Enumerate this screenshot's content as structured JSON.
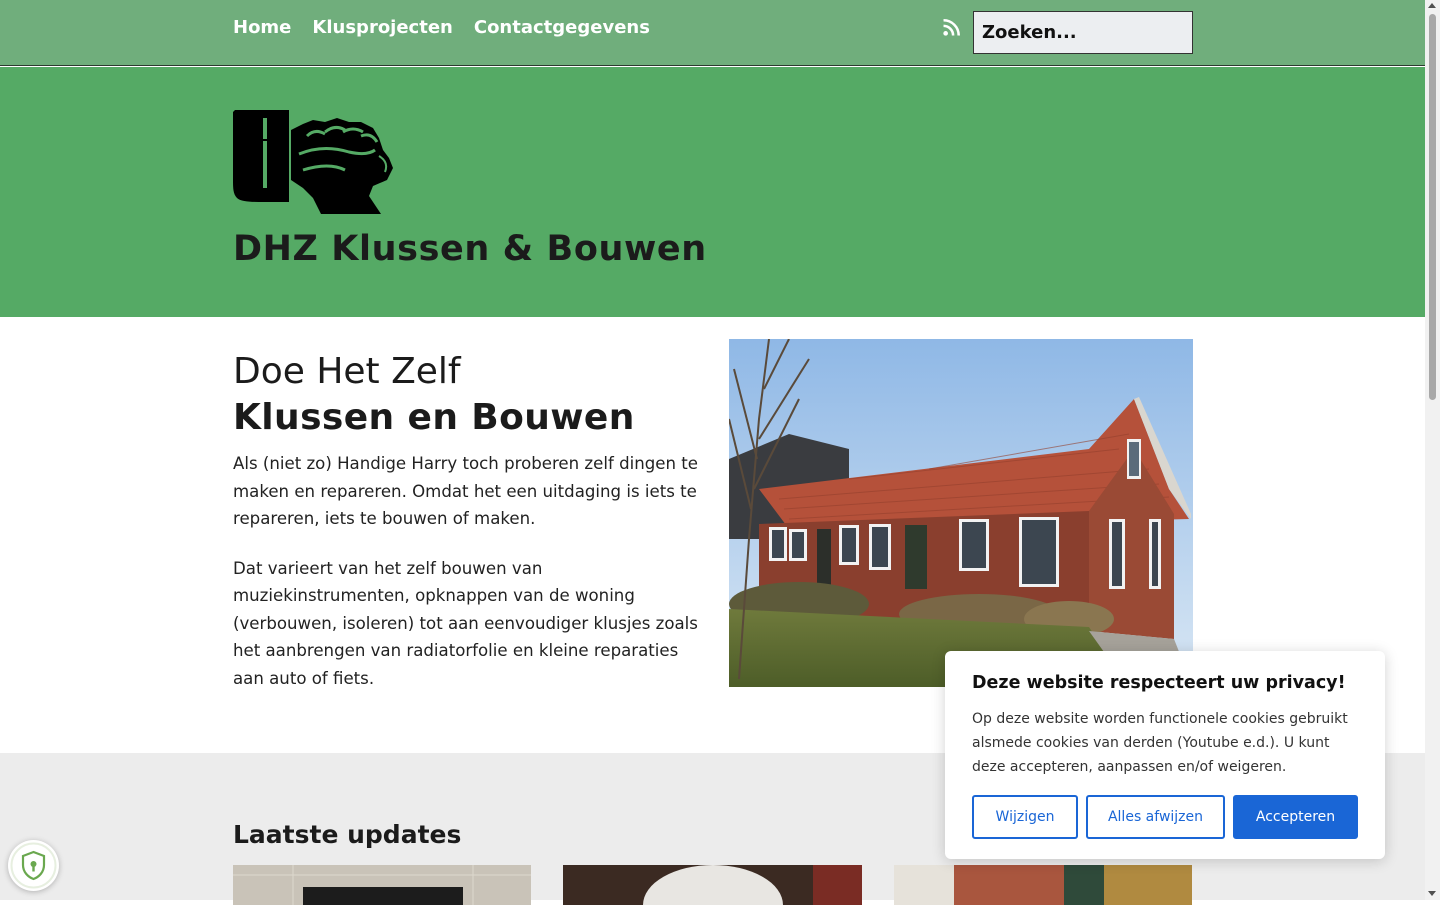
{
  "nav": {
    "items": [
      {
        "label": "Home"
      },
      {
        "label": "Klusprojecten"
      },
      {
        "label": "Contactgegevens"
      }
    ],
    "search_placeholder": "Zoeken..."
  },
  "header": {
    "site_title": "DHZ Klussen & Bouwen"
  },
  "intro": {
    "title_line1": "Doe Het Zelf",
    "title_line2": "Klussen en Bouwen",
    "paragraph1": "Als (niet zo) Handige Harry toch proberen zelf dingen te maken en repareren. Omdat het een uitdaging is iets te repareren, iets te bouwen of maken.",
    "paragraph2": "Dat varieert van het zelf bouwen van muziekinstrumenten, opknappen van de woning (verbouwen, isoleren) tot aan eenvoudiger klusjes zoals het aanbrengen van radiatorfolie en kleine reparaties aan auto of fiets."
  },
  "updates": {
    "heading": "Laatste updates"
  },
  "cookie": {
    "title": "Deze website respecteert uw privacy!",
    "text": "Op deze website worden functionele cookies gebruikt alsmede cookies van derden (Youtube e.d.). U kunt deze accepteren, aanpassen en/of weigeren.",
    "change_label": "Wijzigen",
    "reject_label": "Alles afwijzen",
    "accept_label": "Accepteren"
  },
  "colors": {
    "nav_bg": "#70ae7c",
    "header_bg": "#55aa65",
    "accent": "#1a66d6"
  },
  "icons": [
    "rss-icon",
    "logo-fist-hammer",
    "shield-icon"
  ]
}
